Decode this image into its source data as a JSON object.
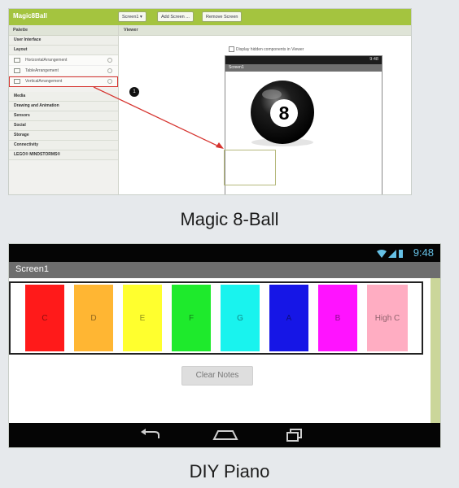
{
  "magic8": {
    "app_title": "Magic8Ball",
    "toolbar_buttons": [
      "Screen1 ▾",
      "Add Screen ...",
      "Remove Screen"
    ],
    "palette_title": "Palette",
    "palette_sections": [
      "User Interface",
      "Layout"
    ],
    "layout_items": [
      "HorizontalArrangement",
      "TableArrangement",
      "VerticalArrangement"
    ],
    "palette_more": [
      "Media",
      "Drawing and Animation",
      "Sensors",
      "Social",
      "Storage",
      "Connectivity",
      "LEGO® MINDSTORMS®"
    ],
    "viewer_title": "Viewer",
    "checkbox_label": "Display hidden components in Viewer",
    "phone_time": "9:48",
    "screen_label": "Screen1",
    "ball_number": "8",
    "badge": "1",
    "caption": "Magic 8-Ball"
  },
  "piano": {
    "time": "9:48",
    "screen_title": "Screen1",
    "keys": [
      {
        "label": "C",
        "color": "#ff1a1a"
      },
      {
        "label": "D",
        "color": "#ffb633"
      },
      {
        "label": "E",
        "color": "#ffff2e"
      },
      {
        "label": "F",
        "color": "#1eea2c"
      },
      {
        "label": "G",
        "color": "#19f3ee"
      },
      {
        "label": "A",
        "color": "#1616e6"
      },
      {
        "label": "B",
        "color": "#ff13ff"
      },
      {
        "label": "High C",
        "color": "#ffadc2"
      }
    ],
    "clear_label": "Clear Notes",
    "caption": "DIY Piano"
  }
}
